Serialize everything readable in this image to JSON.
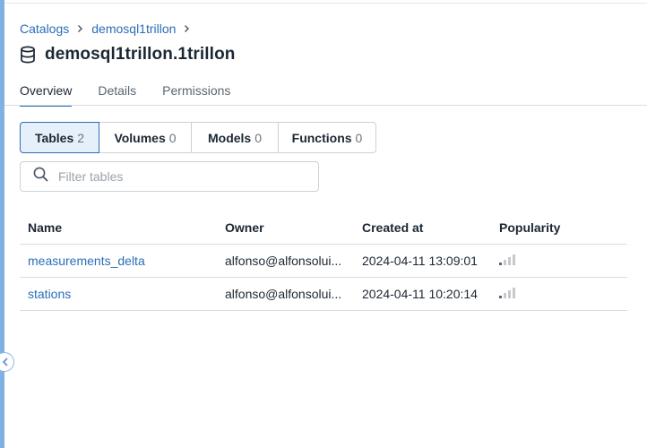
{
  "breadcrumb": {
    "items": [
      "Catalogs",
      "demosql1trillon"
    ]
  },
  "page": {
    "title": "demosql1trillon.1trillon"
  },
  "tabs": [
    {
      "label": "Overview",
      "active": true
    },
    {
      "label": "Details",
      "active": false
    },
    {
      "label": "Permissions",
      "active": false
    }
  ],
  "segments": [
    {
      "label": "Tables",
      "count": "2",
      "active": true
    },
    {
      "label": "Volumes",
      "count": "0",
      "active": false
    },
    {
      "label": "Models",
      "count": "0",
      "active": false
    },
    {
      "label": "Functions",
      "count": "0",
      "active": false
    }
  ],
  "filter": {
    "placeholder": "Filter tables",
    "value": ""
  },
  "table": {
    "columns": [
      "Name",
      "Owner",
      "Created at",
      "Popularity"
    ],
    "rows": [
      {
        "name": "measurements_delta",
        "owner": "alfonso@alfonsolui...",
        "created_at": "2024-04-11 13:09:01",
        "popularity": 0.25
      },
      {
        "name": "stations",
        "owner": "alfonso@alfonsolui...",
        "created_at": "2024-04-11 10:20:14",
        "popularity": 0.25
      }
    ]
  },
  "icons": {
    "title": "database-icon",
    "breadcrumb_separator": "chevron-right-icon",
    "search": "search-icon",
    "collapse": "chevron-left-icon",
    "popularity": "signal-bars-icon"
  },
  "colors": {
    "accent": "#2272b4",
    "link": "#2a6eb7",
    "active_segment_bg": "#e6f0fa",
    "rail": "#7fb1e3"
  }
}
